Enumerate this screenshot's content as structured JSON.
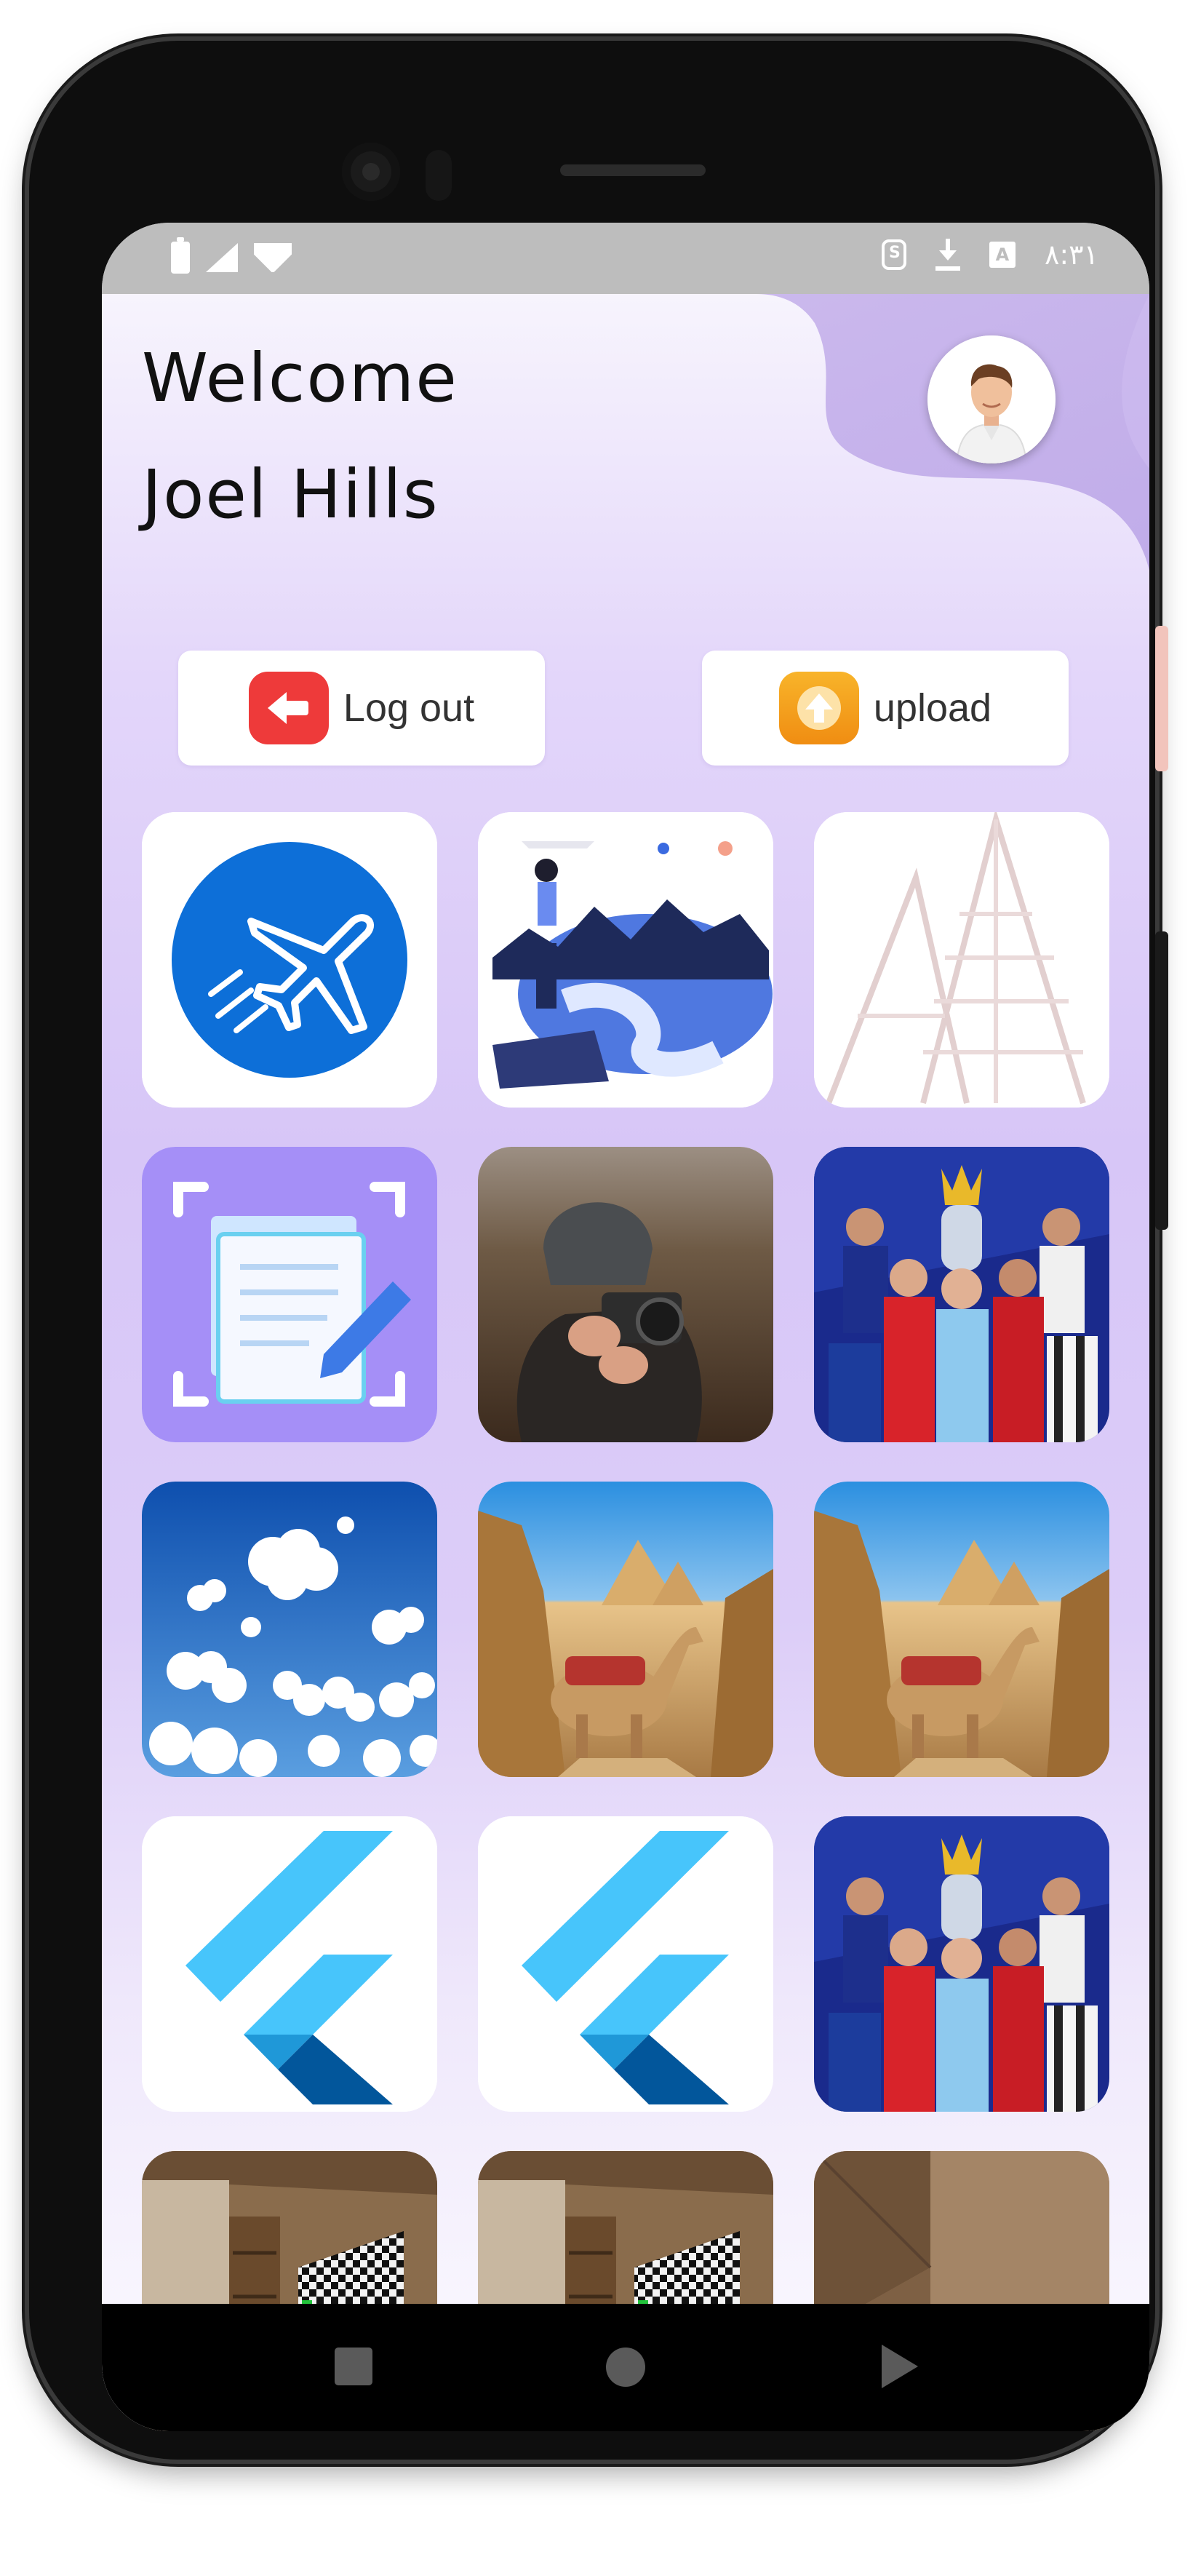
{
  "status_bar": {
    "time": "۸:۳۱",
    "icons": [
      "battery-icon",
      "signal-icon",
      "wifi-icon",
      "sim-icon",
      "download-icon",
      "keyboard-a-icon"
    ],
    "text_color": "#ffffff",
    "background": "#bdbdbd"
  },
  "header": {
    "welcome": "Welcome",
    "user_name": "Joel Hills",
    "avatar_icon": "profile-avatar"
  },
  "actions": {
    "logout_label": "Log out",
    "upload_label": "upload",
    "logout_color": "#ee3a3a",
    "upload_color": "#f59b1a"
  },
  "gallery": [
    {
      "name": "airplane-logo"
    },
    {
      "name": "hiker-illustration"
    },
    {
      "name": "faded-mountains"
    },
    {
      "name": "document-edit-icon"
    },
    {
      "name": "photographer-photo"
    },
    {
      "name": "football-players-trophy"
    },
    {
      "name": "clouds-sky"
    },
    {
      "name": "pyramids-camel"
    },
    {
      "name": "pyramids-camel-2"
    },
    {
      "name": "flutter-logo"
    },
    {
      "name": "flutter-logo-2"
    },
    {
      "name": "football-players-trophy-2"
    },
    {
      "name": "room-checkerboard"
    },
    {
      "name": "room-checkerboard-2"
    },
    {
      "name": "room-corner"
    }
  ],
  "nav_bar": {
    "icons": [
      "back-icon",
      "home-icon",
      "recents-icon"
    ]
  },
  "colors": {
    "accent_purple": "#c9b4f2",
    "flutter_light": "#47c5fb",
    "flutter_dark": "#02569b"
  }
}
